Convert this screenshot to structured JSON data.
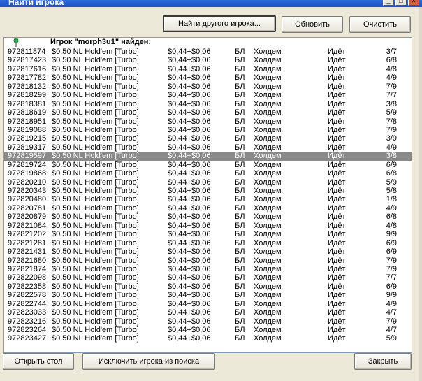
{
  "window": {
    "title": "Найти игрока",
    "min_icon": "minimize-icon",
    "max_icon": "maximize-icon",
    "close_icon": "close-icon"
  },
  "toolbar": {
    "find_other_label": "Найти другого игрока...",
    "refresh_label": "Обновить",
    "clear_label": "Очистить"
  },
  "list": {
    "found_text": "Игрок \"morph3u1\" найден:",
    "pin_icon": "pin-icon",
    "rows": [
      {
        "id": "972811874",
        "game": "$0.50 NL Hold'em [Turbo]",
        "stake": "$0,44+$0,06",
        "type": "БЛ",
        "status": "Холдем",
        "state": "Идёт",
        "players": "3/7"
      },
      {
        "id": "972817423",
        "game": "$0.50 NL Hold'em [Turbo]",
        "stake": "$0,44+$0,06",
        "type": "БЛ",
        "status": "Холдем",
        "state": "Идёт",
        "players": "6/8"
      },
      {
        "id": "972817616",
        "game": "$0.50 NL Hold'em [Turbo]",
        "stake": "$0,44+$0,06",
        "type": "БЛ",
        "status": "Холдем",
        "state": "Идёт",
        "players": "4/8"
      },
      {
        "id": "972817782",
        "game": "$0.50 NL Hold'em [Turbo]",
        "stake": "$0,44+$0,06",
        "type": "БЛ",
        "status": "Холдем",
        "state": "Идёт",
        "players": "4/9"
      },
      {
        "id": "972818132",
        "game": "$0.50 NL Hold'em [Turbo]",
        "stake": "$0,44+$0,06",
        "type": "БЛ",
        "status": "Холдем",
        "state": "Идёт",
        "players": "7/9"
      },
      {
        "id": "972818299",
        "game": "$0.50 NL Hold'em [Turbo]",
        "stake": "$0,44+$0,06",
        "type": "БЛ",
        "status": "Холдем",
        "state": "Идёт",
        "players": "7/7"
      },
      {
        "id": "972818381",
        "game": "$0.50 NL Hold'em [Turbo]",
        "stake": "$0,44+$0,06",
        "type": "БЛ",
        "status": "Холдем",
        "state": "Идёт",
        "players": "3/8"
      },
      {
        "id": "972818619",
        "game": "$0.50 NL Hold'em [Turbo]",
        "stake": "$0,44+$0,06",
        "type": "БЛ",
        "status": "Холдем",
        "state": "Идёт",
        "players": "5/9"
      },
      {
        "id": "972818951",
        "game": "$0.50 NL Hold'em [Turbo]",
        "stake": "$0,44+$0,06",
        "type": "БЛ",
        "status": "Холдем",
        "state": "Идёт",
        "players": "7/8"
      },
      {
        "id": "972819088",
        "game": "$0.50 NL Hold'em [Turbo]",
        "stake": "$0,44+$0,06",
        "type": "БЛ",
        "status": "Холдем",
        "state": "Идёт",
        "players": "7/9"
      },
      {
        "id": "972819215",
        "game": "$0.50 NL Hold'em [Turbo]",
        "stake": "$0,44+$0,06",
        "type": "БЛ",
        "status": "Холдем",
        "state": "Идёт",
        "players": "3/9"
      },
      {
        "id": "972819317",
        "game": "$0.50 NL Hold'em [Turbo]",
        "stake": "$0,44+$0,06",
        "type": "БЛ",
        "status": "Холдем",
        "state": "Идёт",
        "players": "4/9"
      },
      {
        "id": "972819597",
        "game": "$0.50 NL Hold'em [Turbo]",
        "stake": "$0,44+$0,06",
        "type": "БЛ",
        "status": "Холдем",
        "state": "Идёт",
        "players": "3/8",
        "selected": true
      },
      {
        "id": "972819724",
        "game": "$0.50 NL Hold'em [Turbo]",
        "stake": "$0,44+$0,06",
        "type": "БЛ",
        "status": "Холдем",
        "state": "Идёт",
        "players": "6/9"
      },
      {
        "id": "972819868",
        "game": "$0.50 NL Hold'em [Turbo]",
        "stake": "$0,44+$0,06",
        "type": "БЛ",
        "status": "Холдем",
        "state": "Идёт",
        "players": "6/8"
      },
      {
        "id": "972820210",
        "game": "$0.50 NL Hold'em [Turbo]",
        "stake": "$0,44+$0,06",
        "type": "БЛ",
        "status": "Холдем",
        "state": "Идёт",
        "players": "5/9"
      },
      {
        "id": "972820343",
        "game": "$0.50 NL Hold'em [Turbo]",
        "stake": "$0,44+$0,06",
        "type": "БЛ",
        "status": "Холдем",
        "state": "Идёт",
        "players": "5/8"
      },
      {
        "id": "972820480",
        "game": "$0.50 NL Hold'em [Turbo]",
        "stake": "$0,44+$0,06",
        "type": "БЛ",
        "status": "Холдем",
        "state": "Идёт",
        "players": "1/8"
      },
      {
        "id": "972820781",
        "game": "$0.50 NL Hold'em [Turbo]",
        "stake": "$0,44+$0,06",
        "type": "БЛ",
        "status": "Холдем",
        "state": "Идёт",
        "players": "4/9"
      },
      {
        "id": "972820879",
        "game": "$0.50 NL Hold'em [Turbo]",
        "stake": "$0,44+$0,06",
        "type": "БЛ",
        "status": "Холдем",
        "state": "Идёт",
        "players": "6/8"
      },
      {
        "id": "972821084",
        "game": "$0.50 NL Hold'em [Turbo]",
        "stake": "$0,44+$0,06",
        "type": "БЛ",
        "status": "Холдем",
        "state": "Идёт",
        "players": "4/8"
      },
      {
        "id": "972821202",
        "game": "$0.50 NL Hold'em [Turbo]",
        "stake": "$0,44+$0,06",
        "type": "БЛ",
        "status": "Холдем",
        "state": "Идёт",
        "players": "9/9"
      },
      {
        "id": "972821281",
        "game": "$0.50 NL Hold'em [Turbo]",
        "stake": "$0,44+$0,06",
        "type": "БЛ",
        "status": "Холдем",
        "state": "Идёт",
        "players": "6/9"
      },
      {
        "id": "972821431",
        "game": "$0.50 NL Hold'em [Turbo]",
        "stake": "$0,44+$0,06",
        "type": "БЛ",
        "status": "Холдем",
        "state": "Идёт",
        "players": "6/9"
      },
      {
        "id": "972821680",
        "game": "$0.50 NL Hold'em [Turbo]",
        "stake": "$0,44+$0,06",
        "type": "БЛ",
        "status": "Холдем",
        "state": "Идёт",
        "players": "7/9"
      },
      {
        "id": "972821874",
        "game": "$0.50 NL Hold'em [Turbo]",
        "stake": "$0,44+$0,06",
        "type": "БЛ",
        "status": "Холдем",
        "state": "Идёт",
        "players": "7/9"
      },
      {
        "id": "972822098",
        "game": "$0.50 NL Hold'em [Turbo]",
        "stake": "$0,44+$0,06",
        "type": "БЛ",
        "status": "Холдем",
        "state": "Идёт",
        "players": "7/7"
      },
      {
        "id": "972822358",
        "game": "$0.50 NL Hold'em [Turbo]",
        "stake": "$0,44+$0,06",
        "type": "БЛ",
        "status": "Холдем",
        "state": "Идёт",
        "players": "6/9"
      },
      {
        "id": "972822578",
        "game": "$0.50 NL Hold'em [Turbo]",
        "stake": "$0,44+$0,06",
        "type": "БЛ",
        "status": "Холдем",
        "state": "Идёт",
        "players": "9/9"
      },
      {
        "id": "972822744",
        "game": "$0.50 NL Hold'em [Turbo]",
        "stake": "$0,44+$0,06",
        "type": "БЛ",
        "status": "Холдем",
        "state": "Идёт",
        "players": "4/9"
      },
      {
        "id": "972823033",
        "game": "$0.50 NL Hold'em [Turbo]",
        "stake": "$0,44+$0,06",
        "type": "БЛ",
        "status": "Холдем",
        "state": "Идёт",
        "players": "4/7"
      },
      {
        "id": "972823216",
        "game": "$0.50 NL Hold'em [Turbo]",
        "stake": "$0,44+$0,06",
        "type": "БЛ",
        "status": "Холдем",
        "state": "Идёт",
        "players": "7/9"
      },
      {
        "id": "972823264",
        "game": "$0.50 NL Hold'em [Turbo]",
        "stake": "$0,44+$0,06",
        "type": "БЛ",
        "status": "Холдем",
        "state": "Идёт",
        "players": "4/7"
      },
      {
        "id": "972823427",
        "game": "$0.50 NL Hold'em [Turbo]",
        "stake": "$0,44+$0,06",
        "type": "БЛ",
        "status": "Холдем",
        "state": "Идёт",
        "players": "5/9"
      }
    ]
  },
  "footer": {
    "open_table_label": "Открыть стол",
    "exclude_player_label": "Исключить игрока из поиска",
    "close_label": "Закрыть"
  },
  "colors": {
    "selected_row": "#8a8a8a",
    "window_bg": "#ece9d8",
    "titlebar": "#1b4fc4"
  }
}
